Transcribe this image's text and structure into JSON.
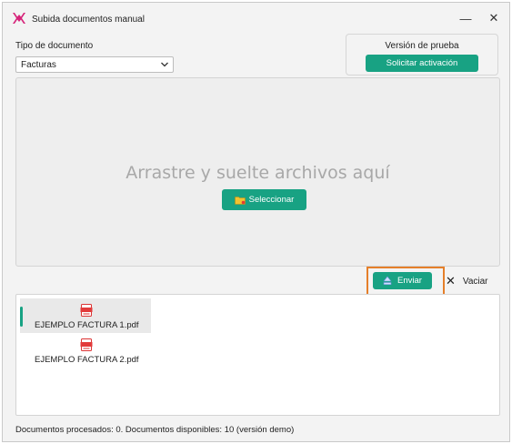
{
  "window": {
    "title": "Subida documentos manual",
    "minimize_symbol": "—",
    "close_symbol": "✕"
  },
  "doc_type": {
    "label": "Tipo de documento",
    "selected": "Facturas"
  },
  "trial": {
    "label": "Versión de prueba",
    "activate_label": "Solicitar activación"
  },
  "dropzone": {
    "text": "Arrastre y suelte archivos aquí",
    "select_label": "Seleccionar"
  },
  "actions": {
    "send_label": "Enviar",
    "clear_label": "Vaciar"
  },
  "files": [
    {
      "name": "EJEMPLO FACTURA 1.pdf",
      "selected": true
    },
    {
      "name": "EJEMPLO FACTURA 2.pdf",
      "selected": false
    }
  ],
  "status": "Documentos procesados: 0.  Documentos disponibles: 10  (versión demo)",
  "colors": {
    "accent": "#18a283",
    "highlight": "#e57f2a",
    "app_icon": "#d6247a"
  },
  "icons": {
    "app": "app-logo-icon",
    "folder": "folder-icon",
    "send": "eject-icon",
    "clear": "x-icon",
    "file": "pdf-icon",
    "dropdown": "chevron-down-icon"
  }
}
